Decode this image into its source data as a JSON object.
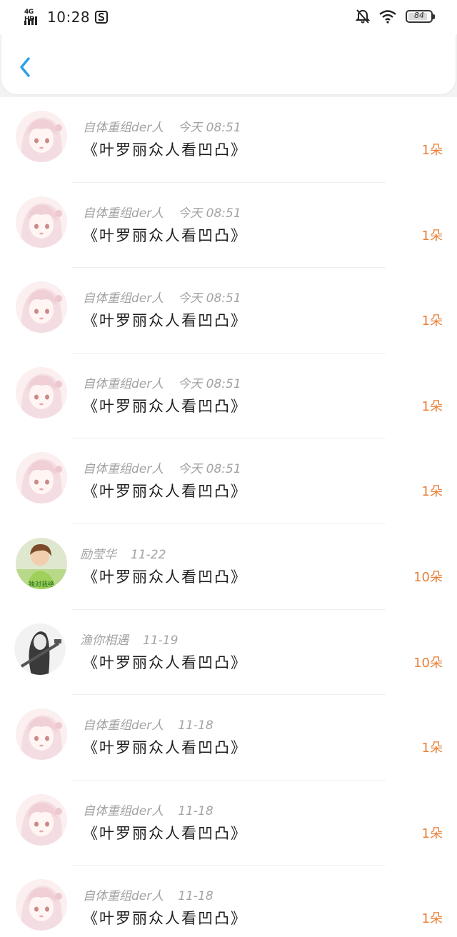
{
  "status_bar": {
    "network": "4G HD",
    "time": "10:28",
    "battery": "84"
  },
  "colors": {
    "accent_back": "#2b9fe8",
    "count_orange": "#e8803a"
  },
  "messages": [
    {
      "sender": "自体重组der人",
      "time": "今天 08:51",
      "title": "《叶罗丽众人看凹凸》",
      "count": "1朵",
      "avatar": "pink-hair-girl"
    },
    {
      "sender": "自体重组der人",
      "time": "今天 08:51",
      "title": "《叶罗丽众人看凹凸》",
      "count": "1朵",
      "avatar": "pink-hair-girl"
    },
    {
      "sender": "自体重组der人",
      "time": "今天 08:51",
      "title": "《叶罗丽众人看凹凸》",
      "count": "1朵",
      "avatar": "pink-hair-girl"
    },
    {
      "sender": "自体重组der人",
      "time": "今天 08:51",
      "title": "《叶罗丽众人看凹凸》",
      "count": "1朵",
      "avatar": "pink-hair-girl"
    },
    {
      "sender": "自体重组der人",
      "time": "今天 08:51",
      "title": "《叶罗丽众人看凹凸》",
      "count": "1朵",
      "avatar": "pink-hair-girl"
    },
    {
      "sender": "励莹华",
      "time": "11-22",
      "title": "《叶罗丽众人看凹凸》",
      "count": "10朵",
      "avatar": "photo-girl",
      "avatar_caption": "独对我绝"
    },
    {
      "sender": "渔你相遇",
      "time": "11-19",
      "title": "《叶罗丽众人看凹凸》",
      "count": "10朵",
      "avatar": "guitar-girl"
    },
    {
      "sender": "自体重组der人",
      "time": "11-18",
      "title": "《叶罗丽众人看凹凸》",
      "count": "1朵",
      "avatar": "pink-hair-girl"
    },
    {
      "sender": "自体重组der人",
      "time": "11-18",
      "title": "《叶罗丽众人看凹凸》",
      "count": "1朵",
      "avatar": "pink-hair-girl"
    },
    {
      "sender": "自体重组der人",
      "time": "11-18",
      "title": "《叶罗丽众人看凹凸》",
      "count": "1朵",
      "avatar": "pink-hair-girl"
    }
  ]
}
